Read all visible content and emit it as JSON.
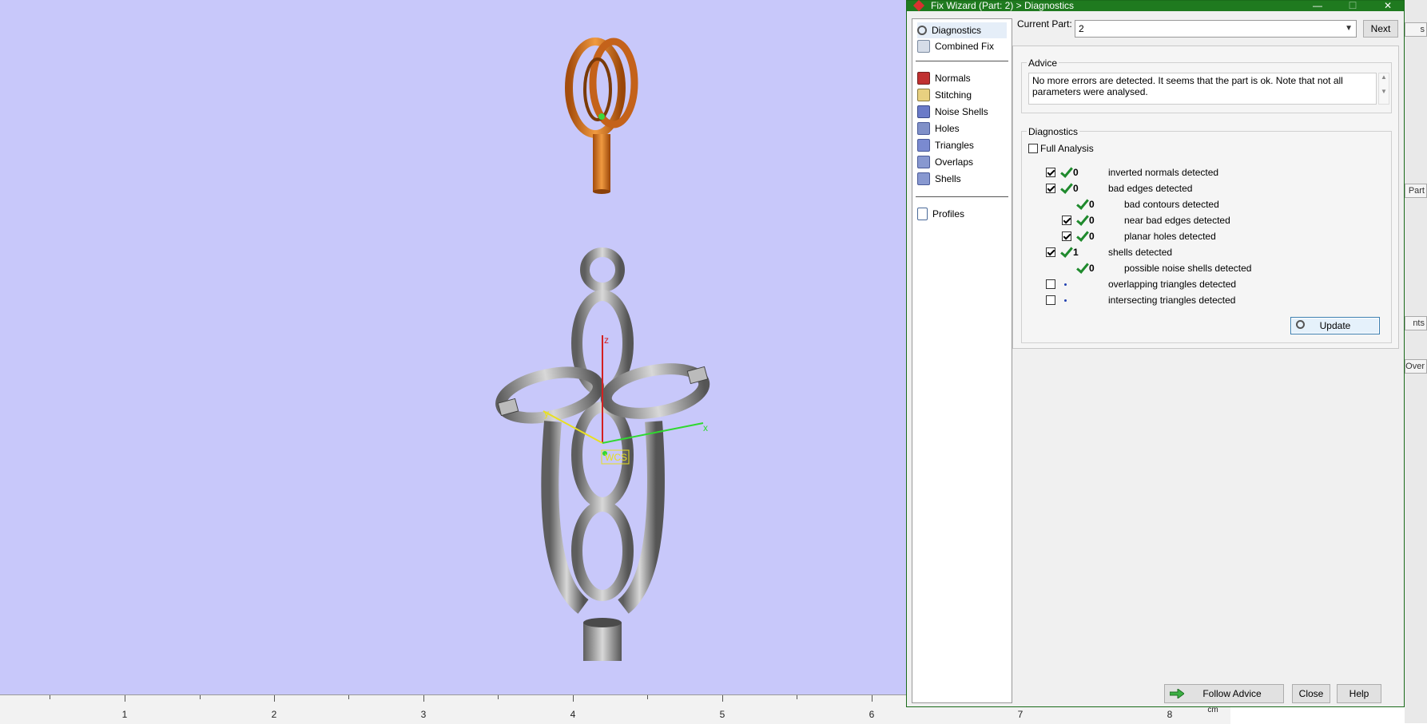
{
  "dialog": {
    "title": "Fix Wizard (Part: 2) > Diagnostics",
    "controls": {
      "minimize": "—",
      "maximize": "☐",
      "close": "✕"
    }
  },
  "nav": {
    "items": [
      {
        "label": "Diagnostics",
        "icon": "magnifier-icon"
      },
      {
        "label": "Combined Fix",
        "icon": "cube-icon"
      },
      {
        "label": "Normals",
        "icon": "normals-cube-icon"
      },
      {
        "label": "Stitching",
        "icon": "stitching-cube-icon"
      },
      {
        "label": "Noise Shells",
        "icon": "noise-shells-cube-icon"
      },
      {
        "label": "Holes",
        "icon": "holes-cube-icon"
      },
      {
        "label": "Triangles",
        "icon": "triangles-cube-icon"
      },
      {
        "label": "Overlaps",
        "icon": "overlaps-cube-icon"
      },
      {
        "label": "Shells",
        "icon": "shells-cube-icon"
      },
      {
        "label": "Profiles",
        "icon": "profiles-document-icon"
      }
    ]
  },
  "current_part": {
    "label": "Current Part:",
    "value": "2",
    "next_label": "Next"
  },
  "advice": {
    "title": "Advice",
    "text": "No more errors are detected. It seems that the part is ok. Note that not all parameters were analysed."
  },
  "diagnostics": {
    "title": "Diagnostics",
    "full_analysis_label": "Full Analysis",
    "rows": [
      {
        "count": "0",
        "label": "inverted normals detected"
      },
      {
        "count": "0",
        "label": "bad edges detected"
      },
      {
        "count": "0",
        "label": "bad contours detected"
      },
      {
        "count": "0",
        "label": "near bad edges detected"
      },
      {
        "count": "0",
        "label": "planar holes detected"
      },
      {
        "count": "1",
        "label": "shells detected"
      },
      {
        "count": "0",
        "label": "possible noise shells detected"
      },
      {
        "count": "",
        "label": "overlapping triangles detected"
      },
      {
        "count": "",
        "label": "intersecting triangles detected"
      }
    ],
    "update_label": "Update"
  },
  "buttons": {
    "follow_advice": "Follow Advice",
    "close": "Close",
    "help": "Help"
  },
  "ruler": {
    "labels": [
      "1",
      "2",
      "3",
      "4",
      "5",
      "6",
      "7",
      "8"
    ],
    "unit": "cm"
  },
  "viewport": {
    "wcs_label": "WCS",
    "axis_labels": {
      "x": "x",
      "y": "y",
      "z": "z"
    }
  },
  "right_strip": {
    "fragments": [
      "s",
      "Part",
      "nts",
      "Over"
    ]
  },
  "colors": {
    "viewport_bg": "#c8c8fa",
    "title_bar": "#1f7a1f",
    "part_orange": "#d9741c",
    "part_gray": "#9a9a9a"
  }
}
